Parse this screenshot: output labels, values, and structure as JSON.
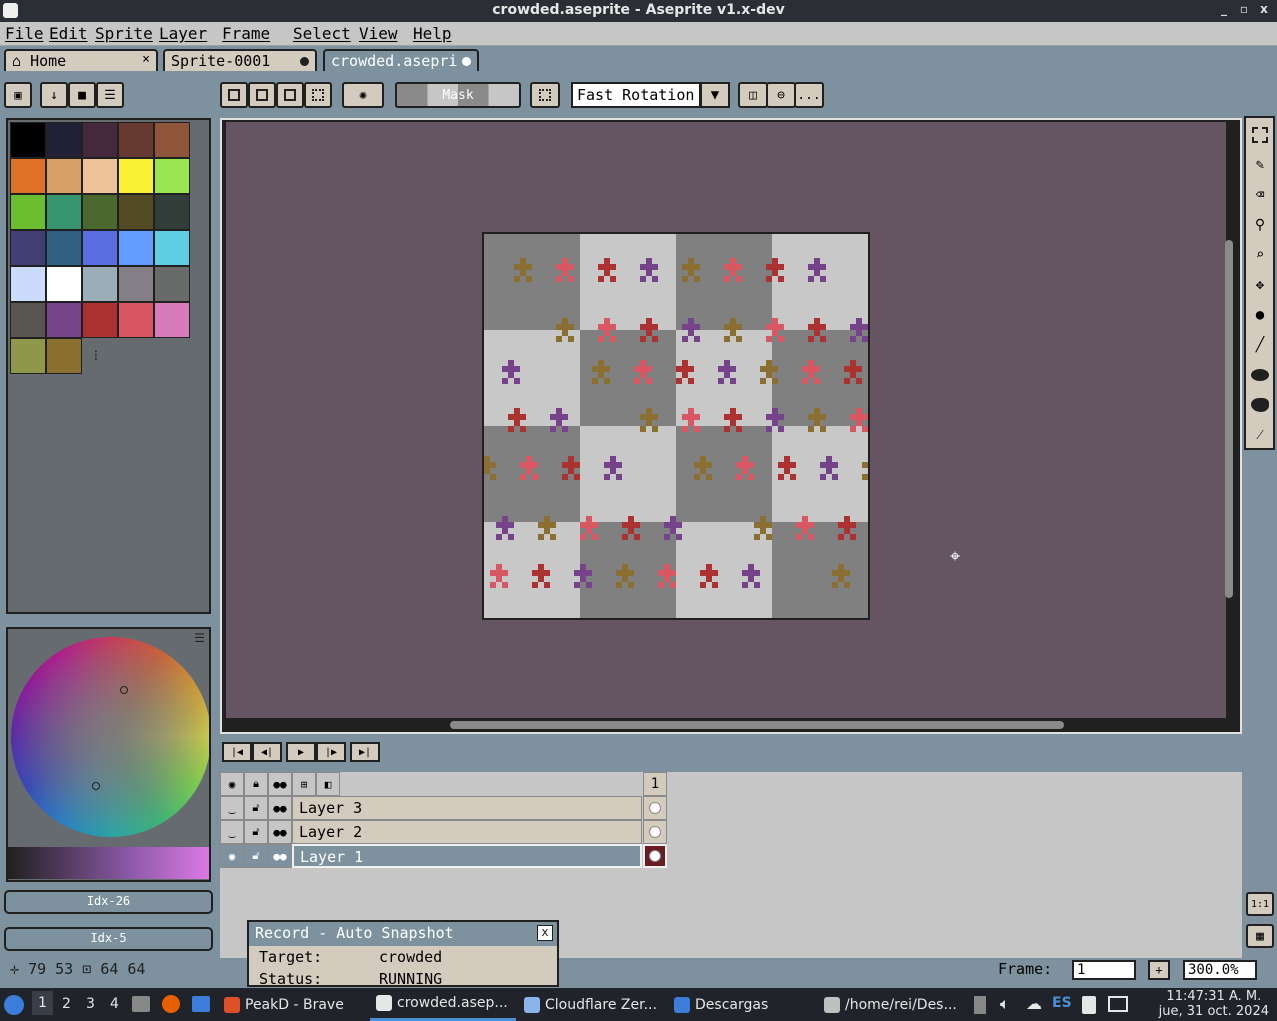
{
  "window": {
    "title": "crowded.aseprite - Aseprite v1.x-dev",
    "minimize": "_",
    "maximize": "▫",
    "close": "x"
  },
  "menu": [
    "File",
    "Edit",
    "Sprite",
    "Layer",
    "Frame",
    "Select",
    "View",
    "Help"
  ],
  "tabs": [
    {
      "label": "Home",
      "close": "×"
    },
    {
      "label": "Sprite-0001"
    },
    {
      "label": "crowded.asepri"
    }
  ],
  "toolbar": {
    "mask_label": "Mask",
    "rotation_algorithm": "Fast Rotation",
    "more": "..."
  },
  "palette": {
    "colors": [
      "#000000",
      "#222034",
      "#45283c",
      "#663931",
      "#8f563b",
      "#df7126",
      "#d9a066",
      "#eec39a",
      "#fbf236",
      "#99e550",
      "#6abe30",
      "#37946e",
      "#4b692f",
      "#524b24",
      "#323c39",
      "#3f3f74",
      "#306082",
      "#5b6ee1",
      "#639bff",
      "#5fcde4",
      "#cbdbfc",
      "#ffffff",
      "#9badb7",
      "#847e87",
      "#696a6a",
      "#595652",
      "#76428a",
      "#ac3232",
      "#d95763",
      "#d77bba",
      "#8f974a",
      "#8a6f30"
    ],
    "resize_handle": "⁞"
  },
  "colors": {
    "foreground": {
      "label": "Idx-26",
      "hex": "#76428a"
    },
    "background": {
      "label": "Idx-5",
      "hex": "#df7126"
    },
    "canvas_bg": "#655563",
    "checker_dark": "#808080",
    "checker_light": "#c8c8c8",
    "sprite_tones": [
      "#8a6f30",
      "#d95763",
      "#ac3232",
      "#76428a"
    ]
  },
  "status": {
    "pos_x": "79",
    "pos_y": "53",
    "size_w": "64",
    "size_h": "64"
  },
  "timeline": {
    "header_frame": "1",
    "layers": [
      {
        "name": "Layer 3",
        "visible": false,
        "selected": false
      },
      {
        "name": "Layer 2",
        "visible": false,
        "selected": false
      },
      {
        "name": "Layer 1",
        "visible": true,
        "selected": true
      }
    ]
  },
  "record": {
    "title": "Record - Auto Snapshot",
    "close": "x",
    "target_label": "Target:",
    "target_value": "crowded",
    "status_label": "Status:",
    "status_value": "RUNNING"
  },
  "frame": {
    "label": "Frame:",
    "value": "1",
    "add": "+",
    "zoom": "300.0%"
  },
  "taskbar": {
    "workspaces": [
      "1",
      "2",
      "3",
      "4"
    ],
    "tasks": [
      {
        "label": "PeakD - Brave",
        "icon_color": "#e0502a"
      },
      {
        "label": "crowded.asep...",
        "icon_color": "#e6e6e6",
        "active": true
      },
      {
        "label": "Cloudflare Zer...",
        "icon_color": "#8ab4e8"
      },
      {
        "label": "Descargas",
        "icon_color": "#3b7dd8"
      },
      {
        "label": "/home/rei/Des...",
        "icon_color": "#c0c0c0"
      }
    ],
    "lang": "ES",
    "time": "11:47:31 A. M.",
    "date": "jue, 31 oct. 2024"
  }
}
